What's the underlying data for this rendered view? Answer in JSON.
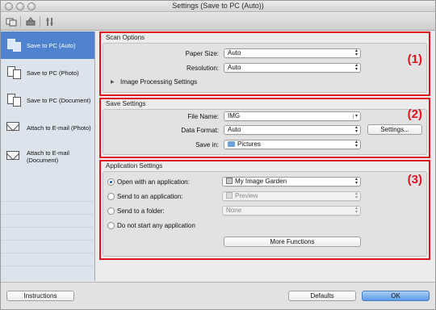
{
  "window": {
    "title": "Settings (Save to PC (Auto))"
  },
  "toolbar": {
    "icons": [
      "scan-from-computer-icon",
      "scan-from-operation-panel-icon",
      "general-settings-icon"
    ]
  },
  "sidebar": {
    "items": [
      {
        "label": "Save to PC (Auto)",
        "icon": "save-pc-icon"
      },
      {
        "label": "Save to PC (Photo)",
        "icon": "save-pc-icon"
      },
      {
        "label": "Save to PC (Document)",
        "icon": "save-pc-icon"
      },
      {
        "label": "Attach to E-mail (Photo)",
        "icon": "email-icon"
      },
      {
        "label": "Attach to E-mail (Document)",
        "icon": "email-icon"
      }
    ]
  },
  "scan_options": {
    "title": "Scan Options",
    "marker": "(1)",
    "paper_size_label": "Paper Size:",
    "paper_size_value": "Auto",
    "resolution_label": "Resolution:",
    "resolution_value": "Auto",
    "image_processing_label": "Image Processing Settings"
  },
  "save_settings": {
    "title": "Save Settings",
    "marker": "(2)",
    "file_name_label": "File Name:",
    "file_name_value": "IMG",
    "data_format_label": "Data Format:",
    "data_format_value": "Auto",
    "settings_button": "Settings...",
    "save_in_label": "Save in:",
    "save_in_value": "Pictures"
  },
  "application_settings": {
    "title": "Application Settings",
    "marker": "(3)",
    "open_with_label": "Open with an application:",
    "open_with_value": "My Image Garden",
    "send_app_label": "Send to an application:",
    "send_app_value": "Preview",
    "send_folder_label": "Send to a folder:",
    "send_folder_value": "None",
    "do_not_start_label": "Do not start any application",
    "more_functions_button": "More Functions",
    "selected_option": "Open with an application"
  },
  "footer": {
    "instructions_button": "Instructions",
    "defaults_button": "Defaults",
    "ok_button": "OK"
  },
  "colors": {
    "highlight_border": "#e0141e",
    "selection": "#4f82cf"
  }
}
